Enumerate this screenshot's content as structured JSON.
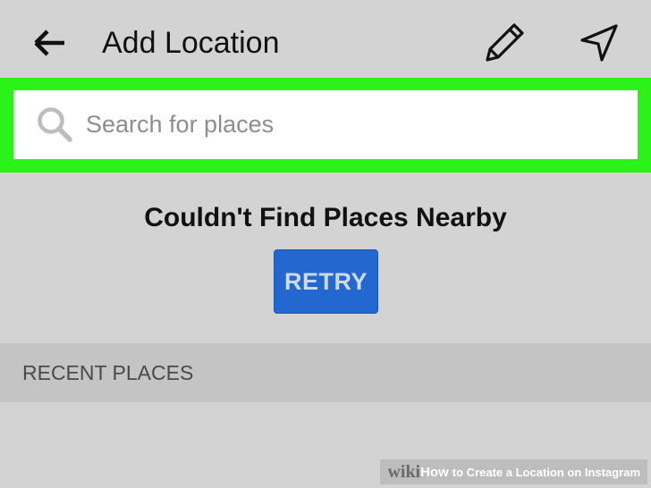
{
  "header": {
    "title": "Add Location",
    "back_icon": "arrow-left-icon",
    "edit_icon": "pencil-icon",
    "nav_icon": "navigation-arrow-icon"
  },
  "search": {
    "placeholder": "Search for places",
    "value": "",
    "icon": "search-icon",
    "highlight_color": "#2bf31a"
  },
  "empty_state": {
    "message": "Couldn't Find Places Nearby",
    "retry_label": "RETRY",
    "retry_color": "#2367d1"
  },
  "recent": {
    "label": "RECENT PLACES"
  },
  "watermark": {
    "wiki": "wiki",
    "how": "How",
    "rest": "to Create a Location on Instagram"
  }
}
